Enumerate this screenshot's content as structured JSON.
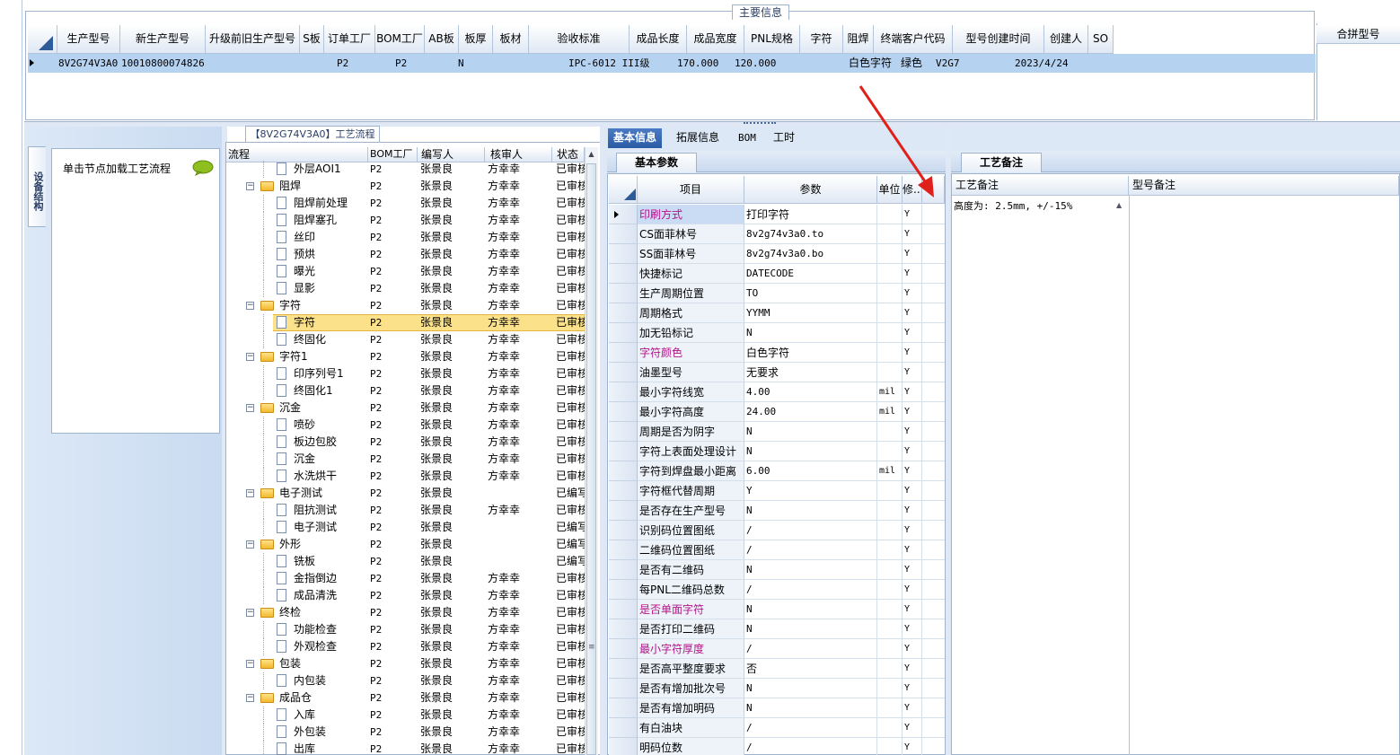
{
  "main_info": {
    "group_title": "主要信息",
    "columns": [
      "生产型号",
      "新生产型号",
      "升级前旧生产型号",
      "S板",
      "订单工厂",
      "BOM工厂",
      "AB板",
      "板厚",
      "板材",
      "验收标准",
      "成品长度",
      "成品宽度",
      "PNL规格",
      "字符",
      "阻焊",
      "终端客户代码",
      "型号创建时间",
      "创建人",
      "SO"
    ],
    "row": {
      "prod_model": "8V2G74V3A0",
      "new_prod_model": "10010800074826",
      "order_factory": "P2",
      "bom_factory": "P2",
      "ab_board": "N",
      "acceptance": "IPC-6012 III级",
      "length": "170.000",
      "width": "120.000",
      "character": "白色字符",
      "solder_mask": "绿色",
      "customer_code": "V2G7",
      "create_time": "2023/4/24"
    },
    "merge_title": "合拼型号"
  },
  "left_panel": {
    "vertical_tab": "设备结构",
    "load_hint": "单击节点加载工艺流程"
  },
  "process_tree": {
    "title": "【8V2G74V3A0】工艺流程",
    "headers": [
      "流程",
      "BOM工厂",
      "编写人",
      "核审人",
      "状态"
    ],
    "rows": [
      {
        "name": "外层AOI1",
        "level": 2,
        "bom": "P2",
        "editor": "张景良",
        "reviewer": "方幸幸",
        "status": "已审核"
      },
      {
        "name": "阻焊",
        "level": 1,
        "bom": "P2",
        "editor": "张景良",
        "reviewer": "方幸幸",
        "status": "已审核"
      },
      {
        "name": "阻焊前处理",
        "level": 2,
        "bom": "P2",
        "editor": "张景良",
        "reviewer": "方幸幸",
        "status": "已审核"
      },
      {
        "name": "阻焊塞孔",
        "level": 2,
        "bom": "P2",
        "editor": "张景良",
        "reviewer": "方幸幸",
        "status": "已审核"
      },
      {
        "name": "丝印",
        "level": 2,
        "bom": "P2",
        "editor": "张景良",
        "reviewer": "方幸幸",
        "status": "已审核"
      },
      {
        "name": "预烘",
        "level": 2,
        "bom": "P2",
        "editor": "张景良",
        "reviewer": "方幸幸",
        "status": "已审核"
      },
      {
        "name": "曝光",
        "level": 2,
        "bom": "P2",
        "editor": "张景良",
        "reviewer": "方幸幸",
        "status": "已审核"
      },
      {
        "name": "显影",
        "level": 2,
        "bom": "P2",
        "editor": "张景良",
        "reviewer": "方幸幸",
        "status": "已审核"
      },
      {
        "name": "字符",
        "level": 1,
        "bom": "P2",
        "editor": "张景良",
        "reviewer": "方幸幸",
        "status": "已审核"
      },
      {
        "name": "字符",
        "level": 2,
        "bom": "P2",
        "editor": "张景良",
        "reviewer": "方幸幸",
        "status": "已审核",
        "selected": true
      },
      {
        "name": "终固化",
        "level": 2,
        "bom": "P2",
        "editor": "张景良",
        "reviewer": "方幸幸",
        "status": "已审核"
      },
      {
        "name": "字符1",
        "level": 1,
        "bom": "P2",
        "editor": "张景良",
        "reviewer": "方幸幸",
        "status": "已审核"
      },
      {
        "name": "印序列号1",
        "level": 2,
        "bom": "P2",
        "editor": "张景良",
        "reviewer": "方幸幸",
        "status": "已审核"
      },
      {
        "name": "终固化1",
        "level": 2,
        "bom": "P2",
        "editor": "张景良",
        "reviewer": "方幸幸",
        "status": "已审核"
      },
      {
        "name": "沉金",
        "level": 1,
        "bom": "P2",
        "editor": "张景良",
        "reviewer": "方幸幸",
        "status": "已审核"
      },
      {
        "name": "喷砂",
        "level": 2,
        "bom": "P2",
        "editor": "张景良",
        "reviewer": "方幸幸",
        "status": "已审核"
      },
      {
        "name": "板边包胶",
        "level": 2,
        "bom": "P2",
        "editor": "张景良",
        "reviewer": "方幸幸",
        "status": "已审核"
      },
      {
        "name": "沉金",
        "level": 2,
        "bom": "P2",
        "editor": "张景良",
        "reviewer": "方幸幸",
        "status": "已审核"
      },
      {
        "name": "水洗烘干",
        "level": 2,
        "bom": "P2",
        "editor": "张景良",
        "reviewer": "方幸幸",
        "status": "已审核"
      },
      {
        "name": "电子测试",
        "level": 1,
        "bom": "P2",
        "editor": "张景良",
        "reviewer": "",
        "status": "已编写"
      },
      {
        "name": "阻抗测试",
        "level": 2,
        "bom": "P2",
        "editor": "张景良",
        "reviewer": "方幸幸",
        "status": "已审核"
      },
      {
        "name": "电子测试",
        "level": 2,
        "bom": "P2",
        "editor": "张景良",
        "reviewer": "",
        "status": "已编写"
      },
      {
        "name": "外形",
        "level": 1,
        "bom": "P2",
        "editor": "张景良",
        "reviewer": "",
        "status": "已编写"
      },
      {
        "name": "铣板",
        "level": 2,
        "bom": "P2",
        "editor": "张景良",
        "reviewer": "",
        "status": "已编写"
      },
      {
        "name": "金指倒边",
        "level": 2,
        "bom": "P2",
        "editor": "张景良",
        "reviewer": "方幸幸",
        "status": "已审核"
      },
      {
        "name": "成品清洗",
        "level": 2,
        "bom": "P2",
        "editor": "张景良",
        "reviewer": "方幸幸",
        "status": "已审核"
      },
      {
        "name": "终检",
        "level": 1,
        "bom": "P2",
        "editor": "张景良",
        "reviewer": "方幸幸",
        "status": "已审核"
      },
      {
        "name": "功能检查",
        "level": 2,
        "bom": "P2",
        "editor": "张景良",
        "reviewer": "方幸幸",
        "status": "已审核"
      },
      {
        "name": "外观检查",
        "level": 2,
        "bom": "P2",
        "editor": "张景良",
        "reviewer": "方幸幸",
        "status": "已审核"
      },
      {
        "name": "包装",
        "level": 1,
        "bom": "P2",
        "editor": "张景良",
        "reviewer": "方幸幸",
        "status": "已审核"
      },
      {
        "name": "内包装",
        "level": 2,
        "bom": "P2",
        "editor": "张景良",
        "reviewer": "方幸幸",
        "status": "已审核"
      },
      {
        "name": "成品仓",
        "level": 1,
        "bom": "P2",
        "editor": "张景良",
        "reviewer": "方幸幸",
        "status": "已审核"
      },
      {
        "name": "入库",
        "level": 2,
        "bom": "P2",
        "editor": "张景良",
        "reviewer": "方幸幸",
        "status": "已审核"
      },
      {
        "name": "外包装",
        "level": 2,
        "bom": "P2",
        "editor": "张景良",
        "reviewer": "方幸幸",
        "status": "已审核"
      },
      {
        "name": "出库",
        "level": 2,
        "bom": "P2",
        "editor": "张景良",
        "reviewer": "方幸幸",
        "status": "已审核"
      }
    ]
  },
  "tabs": [
    "基本信息",
    "拓展信息",
    "BOM",
    "工时"
  ],
  "basic_params": {
    "subtab": "基本参数",
    "headers": [
      "项目",
      "参数",
      "单位",
      "修..."
    ],
    "rows": [
      {
        "item": "印刷方式",
        "value": "打印字符",
        "unit": "",
        "flag": "Y",
        "hl": true
      },
      {
        "item": "CS面菲林号",
        "value": "8v2g74v3a0.to",
        "unit": "",
        "flag": "Y"
      },
      {
        "item": "SS面菲林号",
        "value": "8v2g74v3a0.bo",
        "unit": "",
        "flag": "Y"
      },
      {
        "item": "快捷标记",
        "value": "DATECODE",
        "unit": "",
        "flag": "Y"
      },
      {
        "item": "生产周期位置",
        "value": "TO",
        "unit": "",
        "flag": "Y"
      },
      {
        "item": "周期格式",
        "value": "YYMM",
        "unit": "",
        "flag": "Y"
      },
      {
        "item": "加无铅标记",
        "value": "N",
        "unit": "",
        "flag": "Y"
      },
      {
        "item": "字符颜色",
        "value": "白色字符",
        "unit": "",
        "flag": "Y",
        "hl": true
      },
      {
        "item": "油墨型号",
        "value": "无要求",
        "unit": "",
        "flag": "Y"
      },
      {
        "item": "最小字符线宽",
        "value": "4.00",
        "unit": "mil",
        "flag": "Y"
      },
      {
        "item": "最小字符高度",
        "value": "24.00",
        "unit": "mil",
        "flag": "Y"
      },
      {
        "item": "周期是否为阴字",
        "value": "N",
        "unit": "",
        "flag": "Y"
      },
      {
        "item": "字符上表面处理设计",
        "value": "N",
        "unit": "",
        "flag": "Y"
      },
      {
        "item": "字符到焊盘最小距离",
        "value": "6.00",
        "unit": "mil",
        "flag": "Y"
      },
      {
        "item": "字符框代替周期",
        "value": "Y",
        "unit": "",
        "flag": "Y"
      },
      {
        "item": "是否存在生产型号",
        "value": "N",
        "unit": "",
        "flag": "Y"
      },
      {
        "item": "识别码位置图纸",
        "value": "/",
        "unit": "",
        "flag": "Y"
      },
      {
        "item": "二维码位置图纸",
        "value": "/",
        "unit": "",
        "flag": "Y"
      },
      {
        "item": "是否有二维码",
        "value": "N",
        "unit": "",
        "flag": "Y"
      },
      {
        "item": "每PNL二维码总数",
        "value": "/",
        "unit": "",
        "flag": "Y"
      },
      {
        "item": "是否单面字符",
        "value": "N",
        "unit": "",
        "flag": "Y",
        "hl": true
      },
      {
        "item": "是否打印二维码",
        "value": "N",
        "unit": "",
        "flag": "Y"
      },
      {
        "item": "最小字符厚度",
        "value": "/",
        "unit": "",
        "flag": "Y",
        "hl": true
      },
      {
        "item": "是否高平整度要求",
        "value": "否",
        "unit": "",
        "flag": "Y"
      },
      {
        "item": "是否有增加批次号",
        "value": "N",
        "unit": "",
        "flag": "Y"
      },
      {
        "item": "是否有增加明码",
        "value": "N",
        "unit": "",
        "flag": "Y"
      },
      {
        "item": "有白油块",
        "value": "/",
        "unit": "",
        "flag": "Y"
      },
      {
        "item": "明码位数",
        "value": "/",
        "unit": "",
        "flag": "Y"
      }
    ]
  },
  "process_notes": {
    "tab": "工艺备注",
    "headers": [
      "工艺备注",
      "型号备注"
    ],
    "note": "高度为: 2.5mm, +/-15%"
  },
  "colors": {
    "accent": "#2a5aa3",
    "highlight_text": "#b4128a",
    "selected_row": "#fbe28a",
    "grid_selection": "#b6d2f1",
    "annotation_arrow": "#e0201a"
  }
}
